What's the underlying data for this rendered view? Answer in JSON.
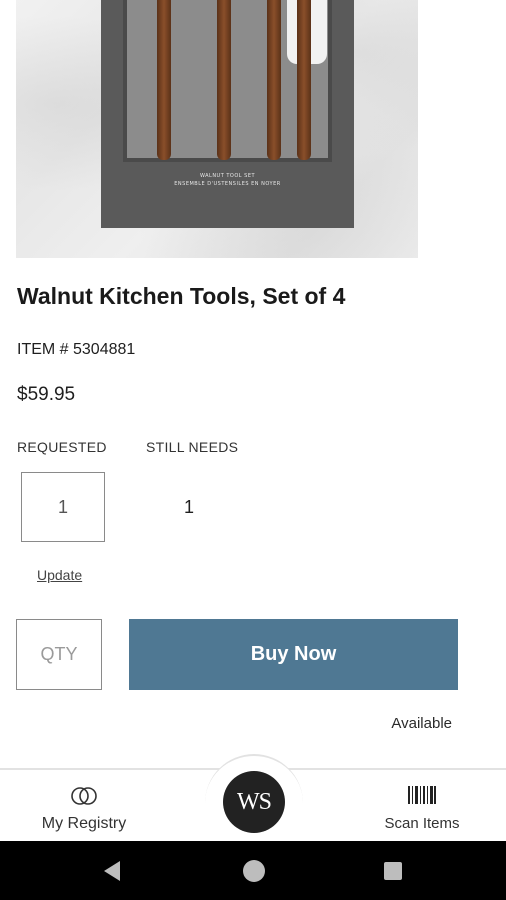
{
  "product": {
    "title": "Walnut Kitchen Tools, Set of 4",
    "item_number": "ITEM # 5304881",
    "price": "$59.95",
    "image_label_line1": "WALNUT TOOL SET",
    "image_label_line2": "ENSEMBLE D'USTENSILES EN NOYER"
  },
  "quantities": {
    "requested_label": "REQUESTED",
    "requested_value": "1",
    "still_needs_label": "STILL NEEDS",
    "still_needs_value": "1",
    "update_link": "Update"
  },
  "purchase": {
    "qty_placeholder": "QTY",
    "buy_button": "Buy Now",
    "availability": "Available",
    "button_color": "#4f7893"
  },
  "bottom_nav": {
    "registry_label": "My Registry",
    "registry_icon": "rings-icon",
    "logo_text": "WS",
    "scan_label": "Scan Items",
    "scan_icon": "barcode-icon"
  },
  "system_bar": {
    "back_icon": "back-triangle-icon",
    "home_icon": "home-circle-icon",
    "recent_icon": "recent-apps-square-icon"
  }
}
